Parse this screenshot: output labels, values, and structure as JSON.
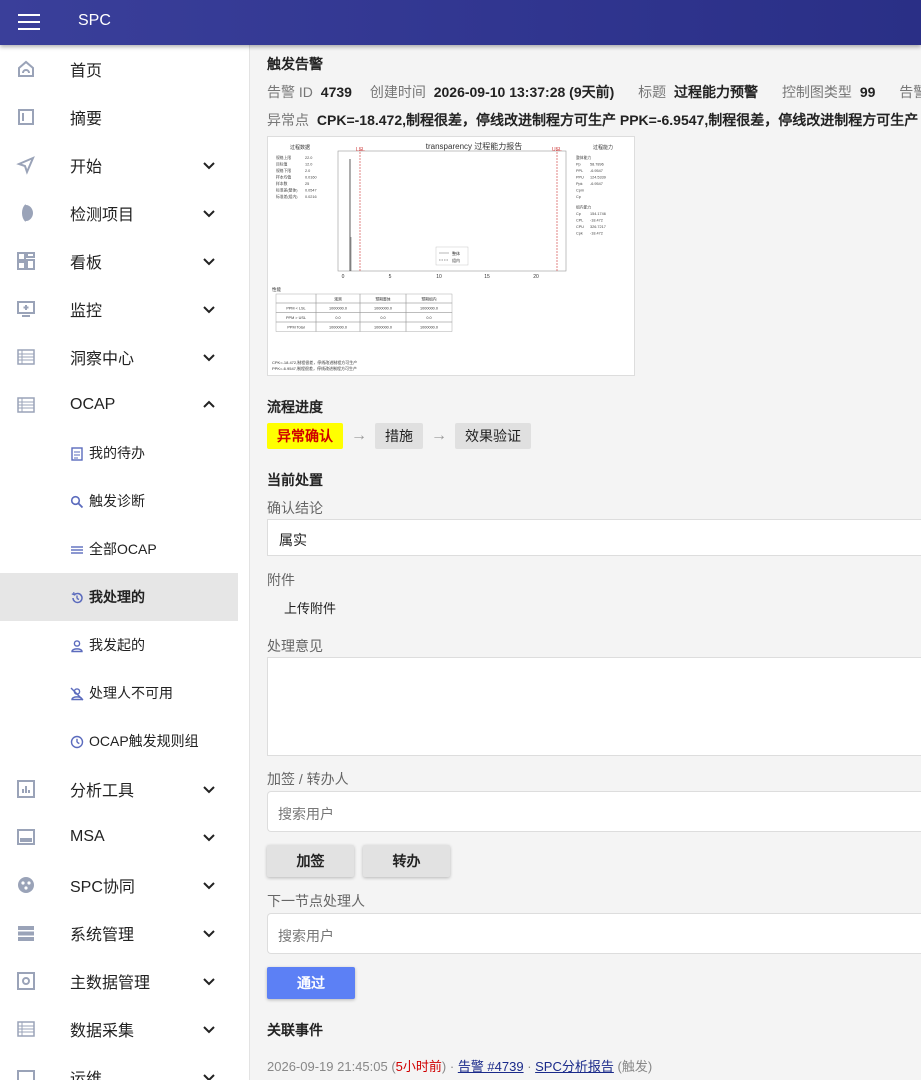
{
  "app": {
    "title": "SPC"
  },
  "sidebar": {
    "items": [
      {
        "label": "首页",
        "icon": "home-icon",
        "has_chevron": false
      },
      {
        "label": "摘要",
        "icon": "document-icon",
        "has_chevron": false
      },
      {
        "label": "开始",
        "icon": "send-icon",
        "has_chevron": true
      },
      {
        "label": "检测项目",
        "icon": "contrast-icon",
        "has_chevron": true
      },
      {
        "label": "看板",
        "icon": "dashboard-icon",
        "has_chevron": true
      },
      {
        "label": "监控",
        "icon": "monitor-icon",
        "has_chevron": true
      },
      {
        "label": "洞察中心",
        "icon": "grid-icon",
        "has_chevron": true
      },
      {
        "label": "OCAP",
        "icon": "grid-icon",
        "has_chevron": true,
        "expanded": true
      }
    ],
    "ocap_sub": [
      {
        "label": "我的待办",
        "icon": "list-icon"
      },
      {
        "label": "触发诊断",
        "icon": "search-icon"
      },
      {
        "label": "全部OCAP",
        "icon": "menu-icon"
      },
      {
        "label": "我处理的",
        "icon": "history-icon",
        "active": true
      },
      {
        "label": "我发起的",
        "icon": "person-icon"
      },
      {
        "label": "处理人不可用",
        "icon": "person-off-icon"
      },
      {
        "label": "OCAP触发规则组",
        "icon": "clock-icon"
      }
    ],
    "items_after": [
      {
        "label": "分析工具",
        "icon": "chart-icon"
      },
      {
        "label": "MSA",
        "icon": "msa-icon"
      },
      {
        "label": "SPC协同",
        "icon": "collab-icon"
      },
      {
        "label": "系统管理",
        "icon": "server-icon"
      },
      {
        "label": "主数据管理",
        "icon": "settings-icon"
      },
      {
        "label": "数据采集",
        "icon": "grid-icon"
      },
      {
        "label": "运维",
        "icon": "tool-icon"
      }
    ]
  },
  "alert": {
    "section_title": "触发告警",
    "id_label": "告警 ID",
    "id_value": "4739",
    "created_label": "创建时间",
    "created_value": "2026-09-10 13:37:28 (9天前)",
    "title_label": "标题",
    "title_value": "过程能力预警",
    "chart_type_label": "控制图类型",
    "chart_type_value": "99",
    "trailing_label": "告警",
    "anomaly_label": "异常点",
    "anomaly_value": "CPK=-18.472,制程很差，停线改进制程方可生产 PPK=-6.9547,制程很差，停线改进制程方可生产"
  },
  "report": {
    "title": "transparency 过程能力报告",
    "left_header": "过程数据",
    "right_header": "过程能力",
    "lsl": "LSL",
    "usl": "USL",
    "left_rows": [
      [
        "规格上限",
        "22.0"
      ],
      [
        "目标值",
        "12.0"
      ],
      [
        "规格下限",
        "2.0"
      ],
      [
        "样本均值",
        "0.0160"
      ],
      [
        "样本数",
        "25"
      ],
      [
        "标准差(整体)",
        "0.0547"
      ],
      [
        "标准差(组内)",
        "0.0216"
      ]
    ],
    "right_rows": [
      [
        "整体能力",
        ""
      ],
      [
        "Pp",
        "58.7896"
      ],
      [
        "PPL",
        "-6.9547"
      ],
      [
        "PPU",
        "124.5339"
      ],
      [
        "Ppk",
        "-6.9547"
      ],
      [
        "Cpm",
        ""
      ],
      [
        "Cp",
        ""
      ],
      [
        "组内能力",
        ""
      ],
      [
        "Cp",
        "154.1746"
      ],
      [
        "CPL",
        "-18.472"
      ],
      [
        "CPU",
        "326.7217"
      ],
      [
        "Cpk",
        "-18.472"
      ]
    ],
    "x_ticks": [
      "0",
      "5",
      "10",
      "15",
      "20"
    ],
    "legend": [
      "整体",
      "组内"
    ],
    "perf_header": "性能",
    "perf_cols": [
      "",
      "观测",
      "预期整体",
      "预期组内"
    ],
    "perf_rows": [
      [
        "PPM < LSL",
        "1000000.0",
        "1000000.0",
        "1000000.0"
      ],
      [
        "PPM > USL",
        "0.0",
        "0.0",
        "0.0"
      ],
      [
        "PPM Total",
        "1000000.0",
        "1000000.0",
        "1000000.0"
      ]
    ],
    "notes": [
      "CPK=-18.472,制程很差，停线改进制程方可生产",
      "PPK=-6.9547,制程很差，停线改进制程方可生产"
    ]
  },
  "flow": {
    "section_title": "流程进度",
    "steps": [
      {
        "label": "异常确认",
        "current": true
      },
      {
        "label": "措施",
        "current": false
      },
      {
        "label": "效果验证",
        "current": false
      }
    ],
    "arrow": "→"
  },
  "disposal": {
    "section_title": "当前处置",
    "conclusion_label": "确认结论",
    "conclusion_value": "属实",
    "attachment_label": "附件",
    "upload_label": "上传附件",
    "opinion_label": "处理意见",
    "cosign_label": "加签 / 转办人",
    "cosign_placeholder": "搜索用户",
    "cosign_button": "加签",
    "transfer_button": "转办",
    "next_label": "下一节点处理人",
    "next_placeholder": "搜索用户",
    "pass_button": "通过"
  },
  "events": {
    "section_title": "关联事件",
    "time": "2026-09-19 21:45:05",
    "ago": "5小时前",
    "sep": " · ",
    "alert_link": "告警 #4739",
    "report_link": "SPC分析报告",
    "suffix": "(触发)"
  },
  "colors": {
    "topbar": "#3a3f9a",
    "primary_button": "#5c80f5",
    "current_step_bg": "#ffff00",
    "current_step_text": "#d00000"
  }
}
